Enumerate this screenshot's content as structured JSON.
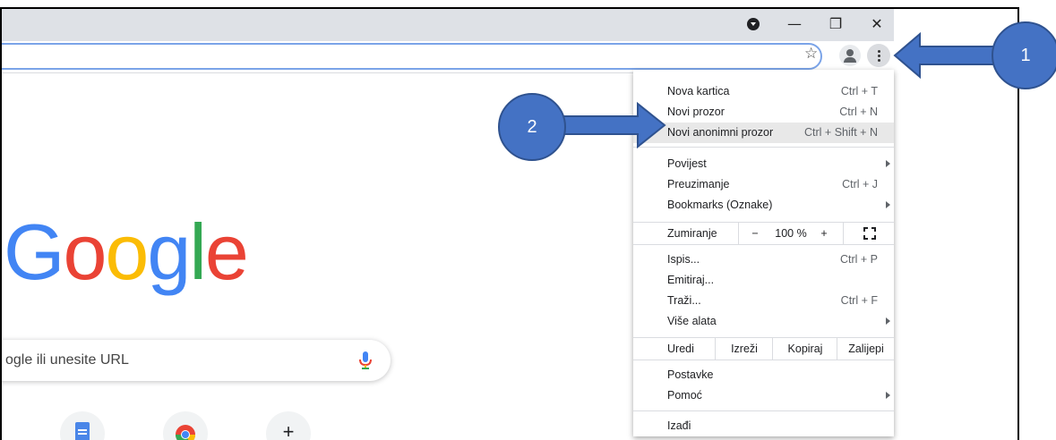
{
  "window": {
    "minimize_icon": "minimize-icon",
    "restore_icon": "restore-icon",
    "close_icon": "close-icon",
    "min_glyph": "—",
    "restore_glyph": "❐",
    "close_glyph": "✕"
  },
  "toolbar": {
    "star_glyph": "☆"
  },
  "page": {
    "logo_letters": [
      {
        "ch": "G",
        "color": "#4285F4"
      },
      {
        "ch": "o",
        "color": "#EA4335"
      },
      {
        "ch": "o",
        "color": "#FBBC05"
      },
      {
        "ch": "g",
        "color": "#4285F4"
      },
      {
        "ch": "l",
        "color": "#34A853"
      },
      {
        "ch": "e",
        "color": "#EA4335"
      }
    ],
    "search_placeholder": "ogle ili unesite URL",
    "add_shortcut_glyph": "+"
  },
  "menu": {
    "new_tab": {
      "label": "Nova kartica",
      "shortcut": "Ctrl + T"
    },
    "new_window": {
      "label": "Novi prozor",
      "shortcut": "Ctrl + N"
    },
    "incognito": {
      "label": "Novi anonimni prozor",
      "shortcut": "Ctrl + Shift + N"
    },
    "history": {
      "label": "Povijest"
    },
    "downloads": {
      "label": "Preuzimanje",
      "shortcut": "Ctrl + J"
    },
    "bookmarks": {
      "label": "Bookmarks (Oznake)"
    },
    "zoom": {
      "label": "Zumiranje",
      "minus": "−",
      "value": "100 %",
      "plus": "+"
    },
    "print": {
      "label": "Ispis...",
      "shortcut": "Ctrl + P"
    },
    "cast": {
      "label": "Emitiraj..."
    },
    "find": {
      "label": "Traži...",
      "shortcut": "Ctrl + F"
    },
    "more_tools": {
      "label": "Više alata"
    },
    "edit": {
      "label": "Uredi",
      "cut": "Izreži",
      "copy": "Kopiraj",
      "paste": "Zalijepi"
    },
    "settings": {
      "label": "Postavke"
    },
    "help": {
      "label": "Pomoć"
    },
    "exit": {
      "label": "Izađi"
    }
  },
  "callouts": {
    "one": "1",
    "two": "2"
  },
  "colors": {
    "callout_fill": "#4472c4",
    "callout_border": "#2f528f",
    "highlight": "#e8e8e8"
  }
}
